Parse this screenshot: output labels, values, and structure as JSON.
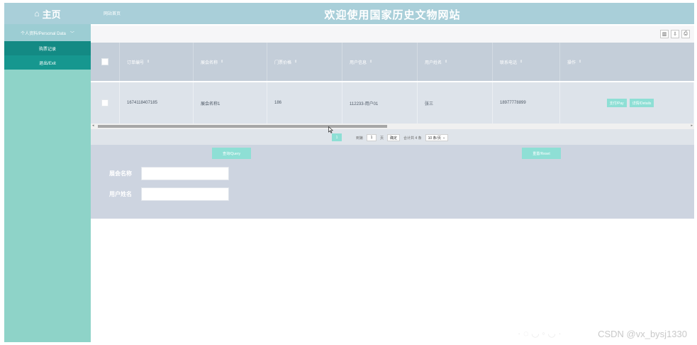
{
  "sidebar": {
    "brand": "主页",
    "brand_icon": "home-icon",
    "group_label": "个人资料/Personal Data",
    "items": [
      {
        "label": "购票记录",
        "active": true
      },
      {
        "label": "退出/Exit",
        "active": false
      }
    ]
  },
  "topbar": {
    "crumb": "网站首页",
    "title": "欢迎使用国家历史文物网站"
  },
  "toolbar": {
    "icons": [
      "columns-icon",
      "export-icon",
      "print-icon"
    ]
  },
  "table": {
    "headers": [
      "订单编号",
      "展会名称",
      "门票价格",
      "用户信息",
      "用户姓名",
      "联系电话",
      "操作"
    ],
    "rows": [
      {
        "order_no": "1674118407185",
        "exhibition": "展会名称1",
        "price": "186",
        "user_info": "112233-用户01",
        "user_name": "张三",
        "phone": "18977778899",
        "actions": [
          "支付/Pay",
          "详情/Details"
        ]
      }
    ]
  },
  "pager": {
    "current_page": "1",
    "goto_label": "到第",
    "goto_value": "1",
    "page_unit": "页",
    "go_button": "确定",
    "total_text": "合计共 4 条",
    "page_size": "10 条/页"
  },
  "search": {
    "query_button": "查询/Query",
    "reset_button": "重置/Reset",
    "fields": [
      {
        "label": "展会名称",
        "value": ""
      },
      {
        "label": "用户姓名",
        "value": ""
      }
    ]
  },
  "watermark": "CSDN @vx_bysj1330",
  "colors": {
    "sidebar": "#8ed3c8",
    "sidebar_active": "#138a84",
    "topbar": "#a9cfd9",
    "accent_button": "#8edfd5",
    "table_header": "#c4ced9",
    "panel": "#cdd4e0"
  }
}
